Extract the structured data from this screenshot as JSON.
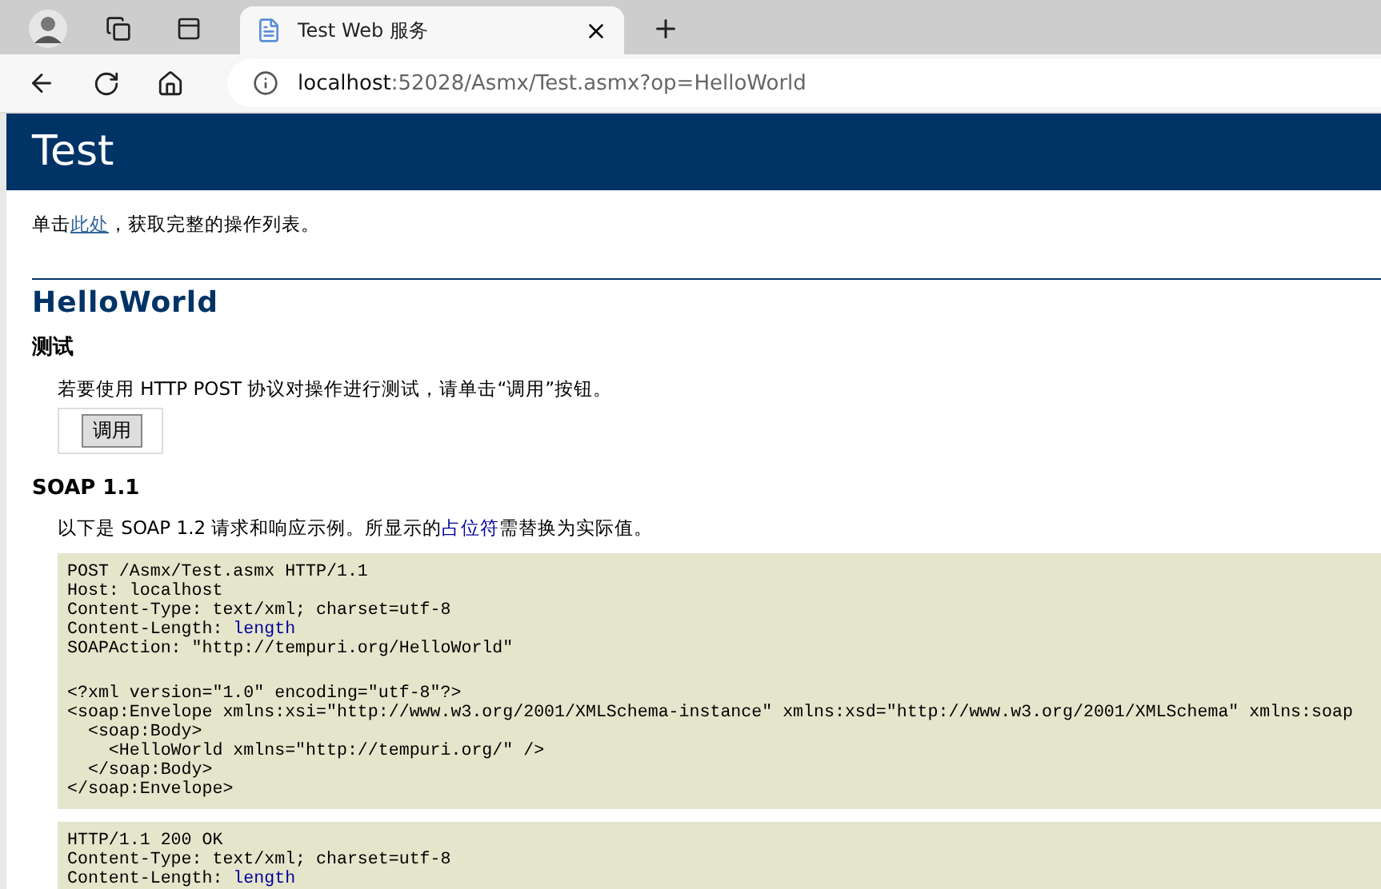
{
  "browser": {
    "tab": {
      "title": "Test Web 服务",
      "selected": true
    },
    "address": {
      "host": "localhost",
      "rest": ":52028/Asmx/Test.asmx?op=HelloWorld"
    }
  },
  "page": {
    "banner": "Test",
    "intro": {
      "before": "单击",
      "link": "此处",
      "after": "，获取完整的操作列表。"
    },
    "operation": "HelloWorld",
    "test": {
      "heading": "测试",
      "text": "若要使用 HTTP POST 协议对操作进行测试，请单击“调用”按钮。",
      "button": "调用"
    },
    "soap": {
      "heading": "SOAP 1.1",
      "intro": {
        "before": "以下是 SOAP 1.2 请求和响应示例。所显示的",
        "link": "占位符",
        "after": "需替换为实际值。"
      },
      "blocks": [
        [
          [
            {
              "text": "POST /Asmx/Test.asmx HTTP/1.1",
              "placeholder": false
            }
          ],
          [
            {
              "text": "Host: localhost",
              "placeholder": false
            }
          ],
          [
            {
              "text": "Content-Type: text/xml; charset=utf-8",
              "placeholder": false
            }
          ],
          [
            {
              "text": "Content-Length: ",
              "placeholder": false
            },
            {
              "text": "length",
              "placeholder": true
            }
          ],
          [
            {
              "text": "SOAPAction: \"http://tempuri.org/HelloWorld\"",
              "placeholder": false
            }
          ],
          [
            {
              "kind": "blank"
            }
          ],
          [
            {
              "text": "<?xml version=\"1.0\" encoding=\"utf-8\"?>",
              "placeholder": false
            }
          ],
          [
            {
              "text": "<soap:Envelope xmlns:xsi=\"http://www.w3.org/2001/XMLSchema-instance\" xmlns:xsd=\"http://www.w3.org/2001/XMLSchema\" xmlns:soap",
              "placeholder": false
            }
          ],
          [
            {
              "text": "  <soap:Body>",
              "placeholder": false
            }
          ],
          [
            {
              "text": "    <HelloWorld xmlns=\"http://tempuri.org/\" />",
              "placeholder": false
            }
          ],
          [
            {
              "text": "  </soap:Body>",
              "placeholder": false
            }
          ],
          [
            {
              "text": "</soap:Envelope>",
              "placeholder": false
            }
          ]
        ],
        [
          [
            {
              "text": "HTTP/1.1 200 OK",
              "placeholder": false
            }
          ],
          [
            {
              "text": "Content-Type: text/xml; charset=utf-8",
              "placeholder": false
            }
          ],
          [
            {
              "text": "Content-Length: ",
              "placeholder": false
            },
            {
              "text": "length",
              "placeholder": true
            }
          ]
        ]
      ]
    }
  }
}
